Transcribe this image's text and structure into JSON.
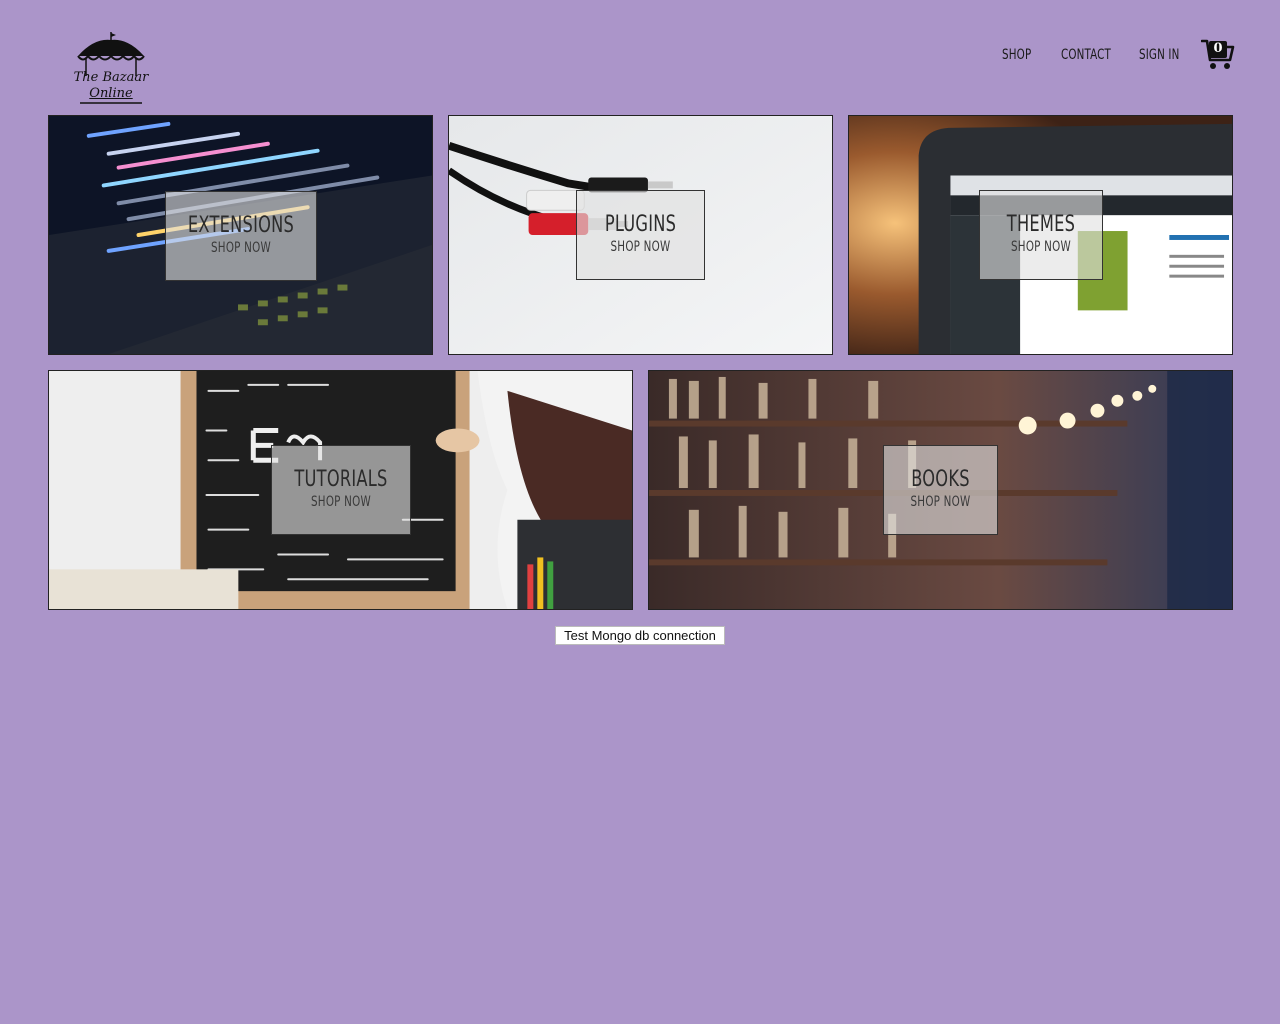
{
  "brand": {
    "logo_line1": "The Bazaar",
    "logo_line2": "Online"
  },
  "nav": {
    "shop": "SHOP",
    "contact": "CONTACT",
    "sign_in": "SIGN IN"
  },
  "cart": {
    "count": "0",
    "icon": "shopping-cart-icon"
  },
  "categories": [
    {
      "title": "EXTENSIONS",
      "cta": "SHOP NOW"
    },
    {
      "title": "PLUGINS",
      "cta": "SHOP NOW"
    },
    {
      "title": "THEMES",
      "cta": "SHOP NOW"
    },
    {
      "title": "TUTORIALS",
      "cta": "SHOP NOW"
    },
    {
      "title": "BOOKS",
      "cta": "SHOP NOW"
    }
  ],
  "test_button": {
    "label": "Test Mongo db connection"
  },
  "colors": {
    "page_background": "#ab95c9",
    "overlay_background": "#e1e1e1"
  }
}
